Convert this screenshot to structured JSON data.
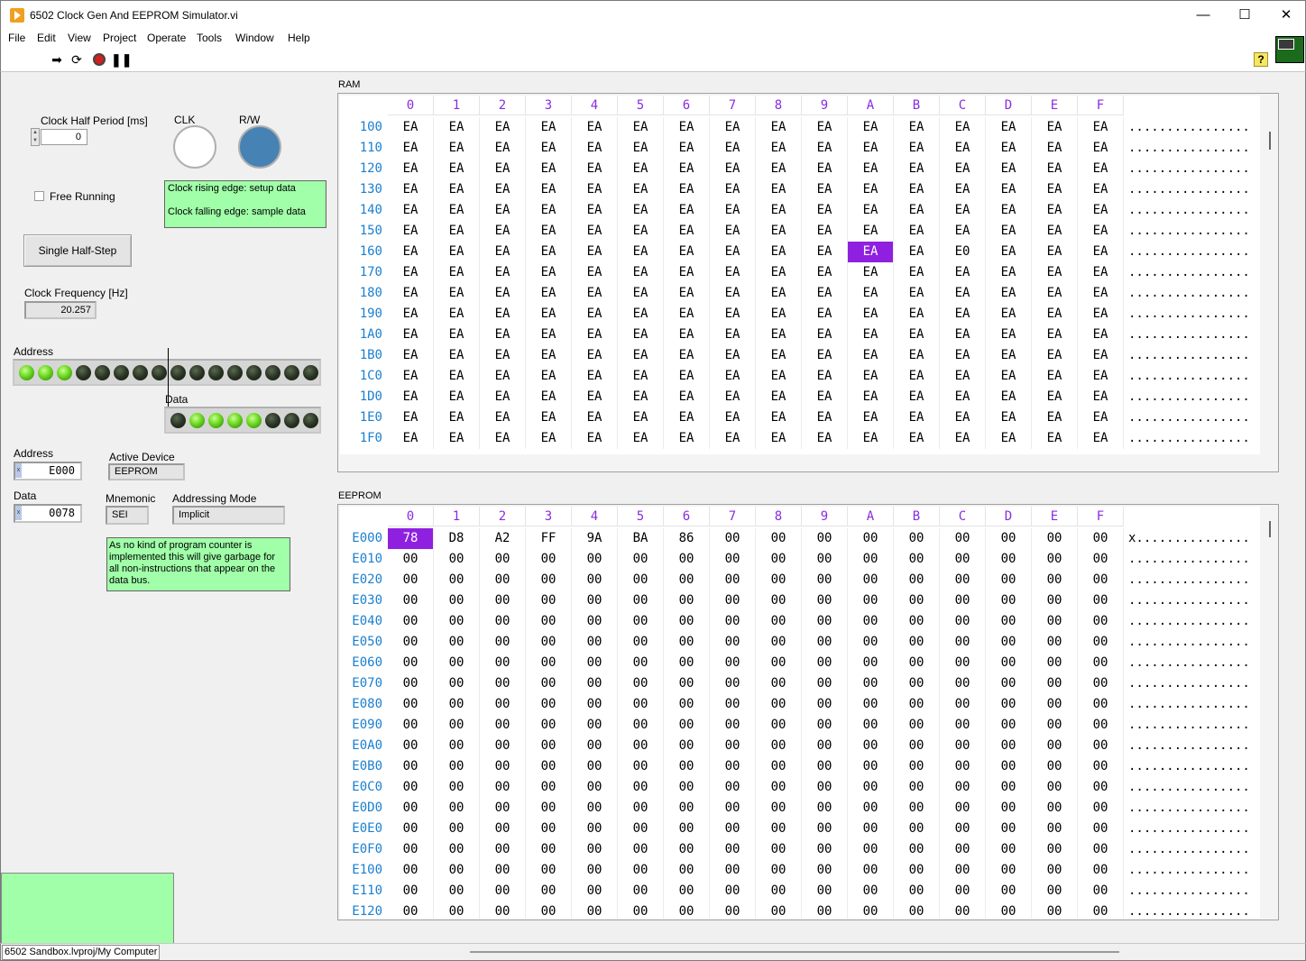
{
  "window": {
    "title": "6502 Clock Gen And EEPROM Simulator.vi",
    "minimize": "—",
    "maximize": "☐",
    "close": "✕"
  },
  "menu": [
    "File",
    "Edit",
    "View",
    "Project",
    "Operate",
    "Tools",
    "Window",
    "Help"
  ],
  "toolbar": {
    "run_icon": "run-arrow-icon",
    "run_continuous_icon": "run-continuously-icon",
    "abort_icon": "abort-icon",
    "pause_icon": "pause-icon",
    "help_label": "?"
  },
  "controls": {
    "clock_half_period_label": "Clock Half Period [ms]",
    "clock_half_period_value": "0",
    "clk_label": "CLK",
    "rw_label": "R/W",
    "clk_color": "#ffffff",
    "rw_color": "#4682b4",
    "edge_note_line1": "Clock rising edge: setup data",
    "edge_note_line2": "Clock falling edge: sample data",
    "free_running_label": "Free Running",
    "single_step_label": "Single Half-Step",
    "clock_freq_label": "Clock Frequency [Hz]",
    "clock_freq_value": "20.257"
  },
  "bus": {
    "address_label": "Address",
    "address_leds": [
      1,
      1,
      1,
      0,
      0,
      0,
      0,
      0,
      0,
      0,
      0,
      0,
      0,
      0,
      0,
      0
    ],
    "data_label": "Data",
    "data_leds": [
      0,
      1,
      1,
      1,
      1,
      0,
      0,
      0
    ]
  },
  "status": {
    "address_label": "Address",
    "address_value": "E000",
    "data_label": "Data",
    "data_value": "0078",
    "active_device_label": "Active Device",
    "active_device_value": "EEPROM",
    "mnemonic_label": "Mnemonic",
    "mnemonic_value": "SEI",
    "addressing_mode_label": "Addressing Mode",
    "addressing_mode_value": "Implicit",
    "radix_marker": "x",
    "note": "As no kind of program counter is implemented this will give garbage for all non-instructions that appear on the data bus."
  },
  "column_headers": [
    "0",
    "1",
    "2",
    "3",
    "4",
    "5",
    "6",
    "7",
    "8",
    "9",
    "A",
    "B",
    "C",
    "D",
    "E",
    "F"
  ],
  "ram": {
    "label": "RAM",
    "selected": {
      "row": 6,
      "col": 10
    },
    "rows": [
      {
        "addr": "100",
        "cells": [
          "EA",
          "EA",
          "EA",
          "EA",
          "EA",
          "EA",
          "EA",
          "EA",
          "EA",
          "EA",
          "EA",
          "EA",
          "EA",
          "EA",
          "EA",
          "EA"
        ],
        "ascii": "................"
      },
      {
        "addr": "110",
        "cells": [
          "EA",
          "EA",
          "EA",
          "EA",
          "EA",
          "EA",
          "EA",
          "EA",
          "EA",
          "EA",
          "EA",
          "EA",
          "EA",
          "EA",
          "EA",
          "EA"
        ],
        "ascii": "................"
      },
      {
        "addr": "120",
        "cells": [
          "EA",
          "EA",
          "EA",
          "EA",
          "EA",
          "EA",
          "EA",
          "EA",
          "EA",
          "EA",
          "EA",
          "EA",
          "EA",
          "EA",
          "EA",
          "EA"
        ],
        "ascii": "................"
      },
      {
        "addr": "130",
        "cells": [
          "EA",
          "EA",
          "EA",
          "EA",
          "EA",
          "EA",
          "EA",
          "EA",
          "EA",
          "EA",
          "EA",
          "EA",
          "EA",
          "EA",
          "EA",
          "EA"
        ],
        "ascii": "................"
      },
      {
        "addr": "140",
        "cells": [
          "EA",
          "EA",
          "EA",
          "EA",
          "EA",
          "EA",
          "EA",
          "EA",
          "EA",
          "EA",
          "EA",
          "EA",
          "EA",
          "EA",
          "EA",
          "EA"
        ],
        "ascii": "................"
      },
      {
        "addr": "150",
        "cells": [
          "EA",
          "EA",
          "EA",
          "EA",
          "EA",
          "EA",
          "EA",
          "EA",
          "EA",
          "EA",
          "EA",
          "EA",
          "EA",
          "EA",
          "EA",
          "EA"
        ],
        "ascii": "................"
      },
      {
        "addr": "160",
        "cells": [
          "EA",
          "EA",
          "EA",
          "EA",
          "EA",
          "EA",
          "EA",
          "EA",
          "EA",
          "EA",
          "EA",
          "EA",
          "E0",
          "EA",
          "EA",
          "EA"
        ],
        "ascii": "................"
      },
      {
        "addr": "170",
        "cells": [
          "EA",
          "EA",
          "EA",
          "EA",
          "EA",
          "EA",
          "EA",
          "EA",
          "EA",
          "EA",
          "EA",
          "EA",
          "EA",
          "EA",
          "EA",
          "EA"
        ],
        "ascii": "................"
      },
      {
        "addr": "180",
        "cells": [
          "EA",
          "EA",
          "EA",
          "EA",
          "EA",
          "EA",
          "EA",
          "EA",
          "EA",
          "EA",
          "EA",
          "EA",
          "EA",
          "EA",
          "EA",
          "EA"
        ],
        "ascii": "................"
      },
      {
        "addr": "190",
        "cells": [
          "EA",
          "EA",
          "EA",
          "EA",
          "EA",
          "EA",
          "EA",
          "EA",
          "EA",
          "EA",
          "EA",
          "EA",
          "EA",
          "EA",
          "EA",
          "EA"
        ],
        "ascii": "................"
      },
      {
        "addr": "1A0",
        "cells": [
          "EA",
          "EA",
          "EA",
          "EA",
          "EA",
          "EA",
          "EA",
          "EA",
          "EA",
          "EA",
          "EA",
          "EA",
          "EA",
          "EA",
          "EA",
          "EA"
        ],
        "ascii": "................"
      },
      {
        "addr": "1B0",
        "cells": [
          "EA",
          "EA",
          "EA",
          "EA",
          "EA",
          "EA",
          "EA",
          "EA",
          "EA",
          "EA",
          "EA",
          "EA",
          "EA",
          "EA",
          "EA",
          "EA"
        ],
        "ascii": "................"
      },
      {
        "addr": "1C0",
        "cells": [
          "EA",
          "EA",
          "EA",
          "EA",
          "EA",
          "EA",
          "EA",
          "EA",
          "EA",
          "EA",
          "EA",
          "EA",
          "EA",
          "EA",
          "EA",
          "EA"
        ],
        "ascii": "................"
      },
      {
        "addr": "1D0",
        "cells": [
          "EA",
          "EA",
          "EA",
          "EA",
          "EA",
          "EA",
          "EA",
          "EA",
          "EA",
          "EA",
          "EA",
          "EA",
          "EA",
          "EA",
          "EA",
          "EA"
        ],
        "ascii": "................"
      },
      {
        "addr": "1E0",
        "cells": [
          "EA",
          "EA",
          "EA",
          "EA",
          "EA",
          "EA",
          "EA",
          "EA",
          "EA",
          "EA",
          "EA",
          "EA",
          "EA",
          "EA",
          "EA",
          "EA"
        ],
        "ascii": "................"
      },
      {
        "addr": "1F0",
        "cells": [
          "EA",
          "EA",
          "EA",
          "EA",
          "EA",
          "EA",
          "EA",
          "EA",
          "EA",
          "EA",
          "EA",
          "EA",
          "EA",
          "EA",
          "EA",
          "EA"
        ],
        "ascii": "................"
      }
    ]
  },
  "eeprom": {
    "label": "EEPROM",
    "selected": {
      "row": 0,
      "col": 0
    },
    "rows": [
      {
        "addr": "E000",
        "cells": [
          "78",
          "D8",
          "A2",
          "FF",
          "9A",
          "BA",
          "86",
          "00",
          "00",
          "00",
          "00",
          "00",
          "00",
          "00",
          "00",
          "00"
        ],
        "ascii": "x..............."
      },
      {
        "addr": "E010",
        "cells": [
          "00",
          "00",
          "00",
          "00",
          "00",
          "00",
          "00",
          "00",
          "00",
          "00",
          "00",
          "00",
          "00",
          "00",
          "00",
          "00"
        ],
        "ascii": "................"
      },
      {
        "addr": "E020",
        "cells": [
          "00",
          "00",
          "00",
          "00",
          "00",
          "00",
          "00",
          "00",
          "00",
          "00",
          "00",
          "00",
          "00",
          "00",
          "00",
          "00"
        ],
        "ascii": "................"
      },
      {
        "addr": "E030",
        "cells": [
          "00",
          "00",
          "00",
          "00",
          "00",
          "00",
          "00",
          "00",
          "00",
          "00",
          "00",
          "00",
          "00",
          "00",
          "00",
          "00"
        ],
        "ascii": "................"
      },
      {
        "addr": "E040",
        "cells": [
          "00",
          "00",
          "00",
          "00",
          "00",
          "00",
          "00",
          "00",
          "00",
          "00",
          "00",
          "00",
          "00",
          "00",
          "00",
          "00"
        ],
        "ascii": "................"
      },
      {
        "addr": "E050",
        "cells": [
          "00",
          "00",
          "00",
          "00",
          "00",
          "00",
          "00",
          "00",
          "00",
          "00",
          "00",
          "00",
          "00",
          "00",
          "00",
          "00"
        ],
        "ascii": "................"
      },
      {
        "addr": "E060",
        "cells": [
          "00",
          "00",
          "00",
          "00",
          "00",
          "00",
          "00",
          "00",
          "00",
          "00",
          "00",
          "00",
          "00",
          "00",
          "00",
          "00"
        ],
        "ascii": "................"
      },
      {
        "addr": "E070",
        "cells": [
          "00",
          "00",
          "00",
          "00",
          "00",
          "00",
          "00",
          "00",
          "00",
          "00",
          "00",
          "00",
          "00",
          "00",
          "00",
          "00"
        ],
        "ascii": "................"
      },
      {
        "addr": "E080",
        "cells": [
          "00",
          "00",
          "00",
          "00",
          "00",
          "00",
          "00",
          "00",
          "00",
          "00",
          "00",
          "00",
          "00",
          "00",
          "00",
          "00"
        ],
        "ascii": "................"
      },
      {
        "addr": "E090",
        "cells": [
          "00",
          "00",
          "00",
          "00",
          "00",
          "00",
          "00",
          "00",
          "00",
          "00",
          "00",
          "00",
          "00",
          "00",
          "00",
          "00"
        ],
        "ascii": "................"
      },
      {
        "addr": "E0A0",
        "cells": [
          "00",
          "00",
          "00",
          "00",
          "00",
          "00",
          "00",
          "00",
          "00",
          "00",
          "00",
          "00",
          "00",
          "00",
          "00",
          "00"
        ],
        "ascii": "................"
      },
      {
        "addr": "E0B0",
        "cells": [
          "00",
          "00",
          "00",
          "00",
          "00",
          "00",
          "00",
          "00",
          "00",
          "00",
          "00",
          "00",
          "00",
          "00",
          "00",
          "00"
        ],
        "ascii": "................"
      },
      {
        "addr": "E0C0",
        "cells": [
          "00",
          "00",
          "00",
          "00",
          "00",
          "00",
          "00",
          "00",
          "00",
          "00",
          "00",
          "00",
          "00",
          "00",
          "00",
          "00"
        ],
        "ascii": "................"
      },
      {
        "addr": "E0D0",
        "cells": [
          "00",
          "00",
          "00",
          "00",
          "00",
          "00",
          "00",
          "00",
          "00",
          "00",
          "00",
          "00",
          "00",
          "00",
          "00",
          "00"
        ],
        "ascii": "................"
      },
      {
        "addr": "E0E0",
        "cells": [
          "00",
          "00",
          "00",
          "00",
          "00",
          "00",
          "00",
          "00",
          "00",
          "00",
          "00",
          "00",
          "00",
          "00",
          "00",
          "00"
        ],
        "ascii": "................"
      },
      {
        "addr": "E0F0",
        "cells": [
          "00",
          "00",
          "00",
          "00",
          "00",
          "00",
          "00",
          "00",
          "00",
          "00",
          "00",
          "00",
          "00",
          "00",
          "00",
          "00"
        ],
        "ascii": "................"
      },
      {
        "addr": "E100",
        "cells": [
          "00",
          "00",
          "00",
          "00",
          "00",
          "00",
          "00",
          "00",
          "00",
          "00",
          "00",
          "00",
          "00",
          "00",
          "00",
          "00"
        ],
        "ascii": "................"
      },
      {
        "addr": "E110",
        "cells": [
          "00",
          "00",
          "00",
          "00",
          "00",
          "00",
          "00",
          "00",
          "00",
          "00",
          "00",
          "00",
          "00",
          "00",
          "00",
          "00"
        ],
        "ascii": "................"
      },
      {
        "addr": "E120",
        "cells": [
          "00",
          "00",
          "00",
          "00",
          "00",
          "00",
          "00",
          "00",
          "00",
          "00",
          "00",
          "00",
          "00",
          "00",
          "00",
          "00"
        ],
        "ascii": "................"
      }
    ]
  },
  "statusbar": {
    "path": "6502 Sandbox.lvproj/My Computer"
  }
}
